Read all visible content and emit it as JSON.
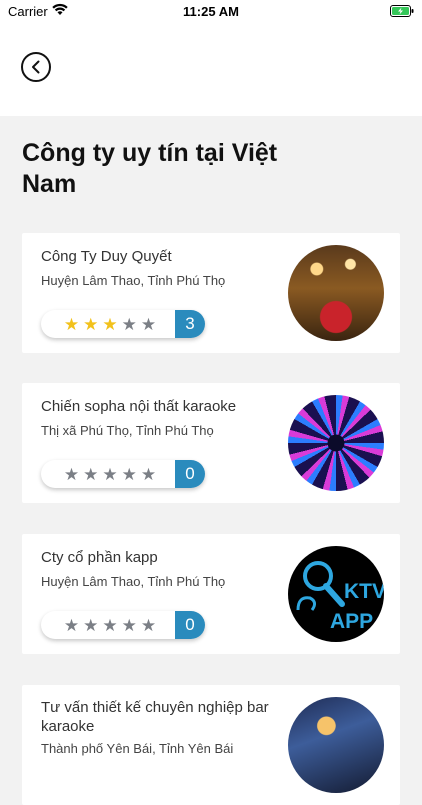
{
  "status": {
    "carrier": "Carrier",
    "time": "11:25 AM"
  },
  "title": "Công ty uy tín tại Việt Nam",
  "companies": [
    {
      "name": "Công Ty Duy Quyết",
      "address": "Huyện Lâm Thao, Tỉnh Phú Thọ",
      "rating": 3,
      "count": "3"
    },
    {
      "name": "Chiến sopha nội thất karaoke",
      "address": "Thị xã Phú Thọ, Tỉnh Phú Thọ",
      "rating": 0,
      "count": "0"
    },
    {
      "name": "Cty cổ phần kapp",
      "address": "Huyện Lâm Thao, Tỉnh Phú Thọ",
      "rating": 0,
      "count": "0"
    },
    {
      "name": "Tư vấn thiết kế chuyên nghiệp bar karaoke",
      "address": "Thành phố Yên Bái, Tỉnh Yên Bái",
      "rating": null,
      "count": ""
    }
  ],
  "thumb3_text": [
    "KTV",
    "APP"
  ],
  "colors": {
    "accent": "#2a8bbd",
    "star_on": "#f2c11b",
    "star_off": "#7b7f86"
  }
}
